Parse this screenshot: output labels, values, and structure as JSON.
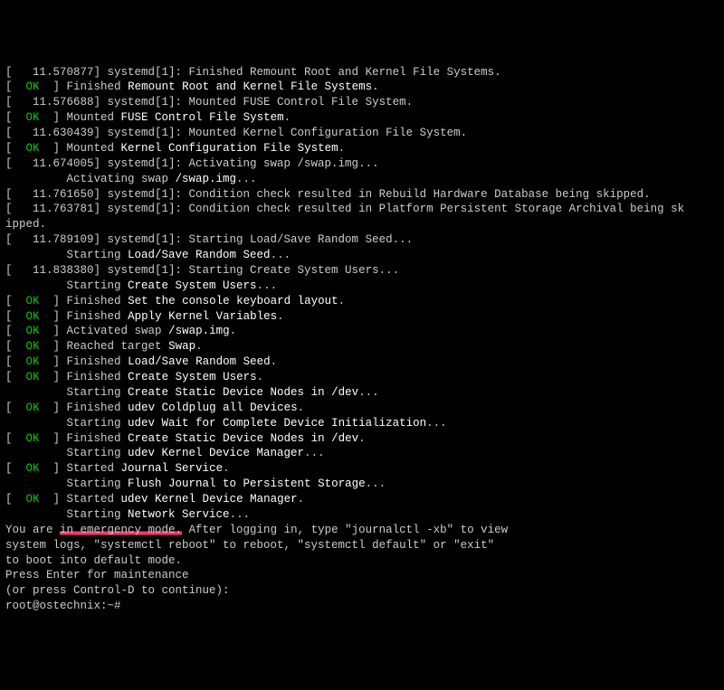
{
  "lines": {
    "l0a": "[   11.570877] systemd[1]: Finished Remount Root and Kernel File Systems.",
    "l0b_a": "[  ",
    "l0b_ok": "OK",
    "l0b_b": "  ] Finished ",
    "l0b_c": "Remount Root and Kernel File Systems",
    "l0b_d": ".",
    "l1a": "[   11.576688] systemd[1]: Mounted FUSE Control File System.",
    "l1b_a": "[  ",
    "l1b_ok": "OK",
    "l1b_b": "  ] Mounted ",
    "l1b_c": "FUSE Control File System",
    "l1b_d": ".",
    "l2a": "[   11.630439] systemd[1]: Mounted Kernel Configuration File System.",
    "l2b_a": "[  ",
    "l2b_ok": "OK",
    "l2b_b": "  ] Mounted ",
    "l2b_c": "Kernel Configuration File System",
    "l2b_d": ".",
    "l3a": "[   11.674005] systemd[1]: Activating swap /swap.img...",
    "l3b_a": "         Activating swap ",
    "l3b_b": "/swap.img",
    "l3b_c": "...",
    "l4": "[   11.761650] systemd[1]: Condition check resulted in Rebuild Hardware Database being skipped.",
    "l5a": "[   11.763781] systemd[1]: Condition check resulted in Platform Persistent Storage Archival being sk",
    "l5b": "ipped.",
    "l6a": "[   11.789109] systemd[1]: Starting Load/Save Random Seed...",
    "l6b_a": "         Starting ",
    "l6b_b": "Load/Save Random Seed",
    "l6b_c": "...",
    "l7a": "[   11.838380] systemd[1]: Starting Create System Users...",
    "l7b_a": "         Starting ",
    "l7b_b": "Create System Users",
    "l7b_c": "...",
    "l8_a": "[  ",
    "l8_ok": "OK",
    "l8_b": "  ] Finished ",
    "l8_c": "Set the console keyboard layout",
    "l8_d": ".",
    "l9_a": "[  ",
    "l9_ok": "OK",
    "l9_b": "  ] Finished ",
    "l9_c": "Apply Kernel Variables",
    "l9_d": ".",
    "l10_a": "[  ",
    "l10_ok": "OK",
    "l10_b": "  ] Activated swap ",
    "l10_c": "/swap.img",
    "l10_d": ".",
    "l11_a": "[  ",
    "l11_ok": "OK",
    "l11_b": "  ] Reached target ",
    "l11_c": "Swap",
    "l11_d": ".",
    "l12_a": "[  ",
    "l12_ok": "OK",
    "l12_b": "  ] Finished ",
    "l12_c": "Load/Save Random Seed",
    "l12_d": ".",
    "l13_a": "[  ",
    "l13_ok": "OK",
    "l13_b": "  ] Finished ",
    "l13_c": "Create System Users",
    "l13_d": ".",
    "l14_a": "         Starting ",
    "l14_b": "Create Static Device Nodes in /dev",
    "l14_c": "...",
    "l15_a": "[  ",
    "l15_ok": "OK",
    "l15_b": "  ] Finished ",
    "l15_c": "udev Coldplug all Devices",
    "l15_d": ".",
    "l16_a": "         Starting ",
    "l16_b": "udev Wait for Complete Device Initialization",
    "l16_c": "...",
    "l17_a": "[  ",
    "l17_ok": "OK",
    "l17_b": "  ] Finished ",
    "l17_c": "Create Static Device Nodes in /dev",
    "l17_d": ".",
    "l18_a": "         Starting ",
    "l18_b": "udev Kernel Device Manager",
    "l18_c": "...",
    "l19_a": "[  ",
    "l19_ok": "OK",
    "l19_b": "  ] Started ",
    "l19_c": "Journal Service",
    "l19_d": ".",
    "l20_a": "         Starting ",
    "l20_b": "Flush Journal to Persistent Storage",
    "l20_c": "...",
    "l21_a": "[  ",
    "l21_ok": "OK",
    "l21_b": "  ] Started ",
    "l21_c": "udev Kernel Device Manager",
    "l21_d": ".",
    "l22_a": "         Starting ",
    "l22_b": "Network Service",
    "l22_c": "...",
    "l23_a": "You are ",
    "l23_b": "in emergency mode.",
    "l23_c": " After logging in, type \"journalctl -xb\" to view",
    "l24": "system logs, \"systemctl reboot\" to reboot, \"systemctl default\" or \"exit\"",
    "l25": "to boot into default mode.",
    "l26": "Press Enter for maintenance",
    "l27": "(or press Control-D to continue):",
    "prompt": "root@ostechnix:~#"
  }
}
